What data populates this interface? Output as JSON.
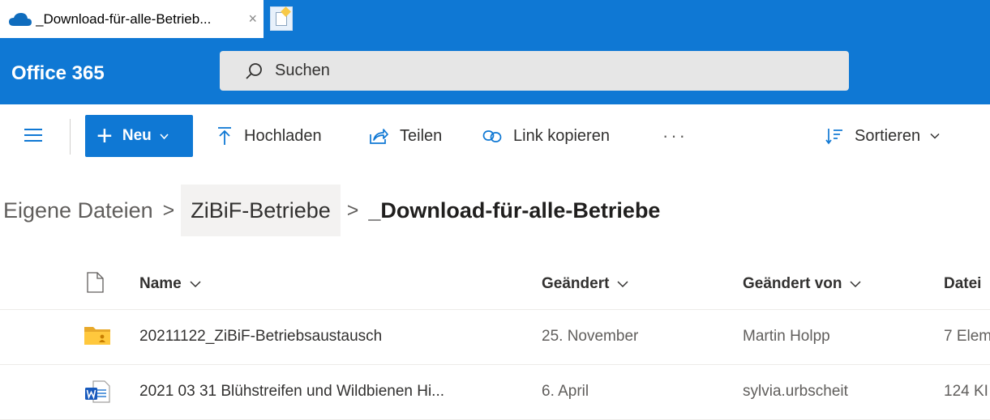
{
  "browser": {
    "tab_title": "_Download-für-alle-Betrieb...",
    "close_glyph": "×",
    "accent": "#0f78d4"
  },
  "suite": {
    "brand": "Office 365",
    "search_placeholder": "Suchen"
  },
  "commands": {
    "new_label": "Neu",
    "upload_label": "Hochladen",
    "share_label": "Teilen",
    "copy_link_label": "Link kopieren",
    "more_label": "···",
    "sort_label": "Sortieren"
  },
  "breadcrumb": {
    "root": "Eigene Dateien",
    "parent": "ZiBiF-Betriebe",
    "current": "_Download-für-alle-Betriebe",
    "separator": ">"
  },
  "columns": {
    "name": "Name",
    "modified": "Geändert",
    "modified_by": "Geändert von",
    "size": "Datei"
  },
  "files": [
    {
      "type": "shared-folder-icon",
      "name": "20211122_ZiBiF-Betriebsaustausch",
      "modified": "25. November",
      "modified_by": "Martin Holpp",
      "size": "7 Elem"
    },
    {
      "type": "word-document-icon",
      "name": "2021 03 31 Blühstreifen  und Wildbienen Hi...",
      "modified": "6. April",
      "modified_by": "sylvia.urbscheit",
      "size": "124 KI"
    }
  ]
}
